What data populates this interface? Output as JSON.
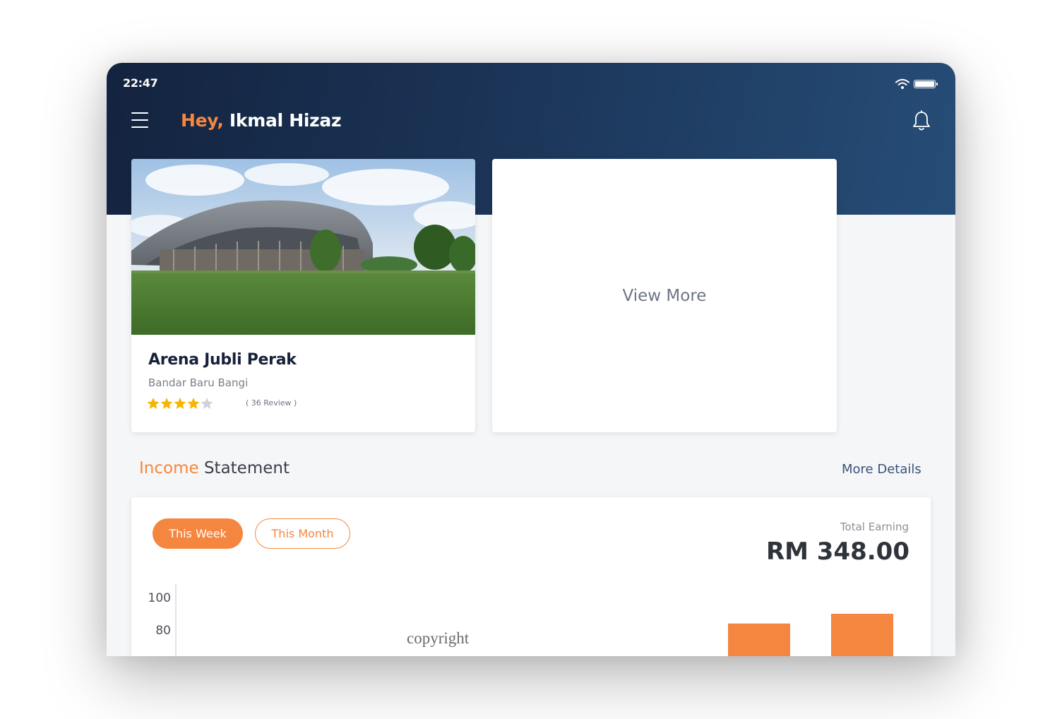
{
  "status_bar": {
    "time": "22:47"
  },
  "header": {
    "greeting_prefix": "Hey,",
    "user_name": " Ikmal Hizaz",
    "menu_icon": "hamburger-menu-icon",
    "notification_icon": "bell-icon"
  },
  "venue": {
    "name": "Arena Jubli Perak",
    "location": "Bandar Baru Bangi",
    "rating": 4,
    "rating_max": 5,
    "reviews": "( 36 Review )"
  },
  "view_more": {
    "label": "View More"
  },
  "income": {
    "title_accent": "Income",
    "title_rest": " Statement",
    "more_details": "More Details",
    "tabs": [
      {
        "label": "This Week",
        "active": true
      },
      {
        "label": "This Month",
        "active": false
      }
    ],
    "total_label": "Total Earning",
    "total_value": "RM 348.00"
  },
  "chart_data": {
    "type": "bar",
    "y_ticks": [
      "100",
      "80"
    ],
    "values": [
      84,
      90
    ],
    "color": "#f5863f"
  },
  "watermark": "copyright",
  "colors": {
    "accent": "#f5863f",
    "header_dark": "#13233f",
    "header_light": "#264d77"
  }
}
